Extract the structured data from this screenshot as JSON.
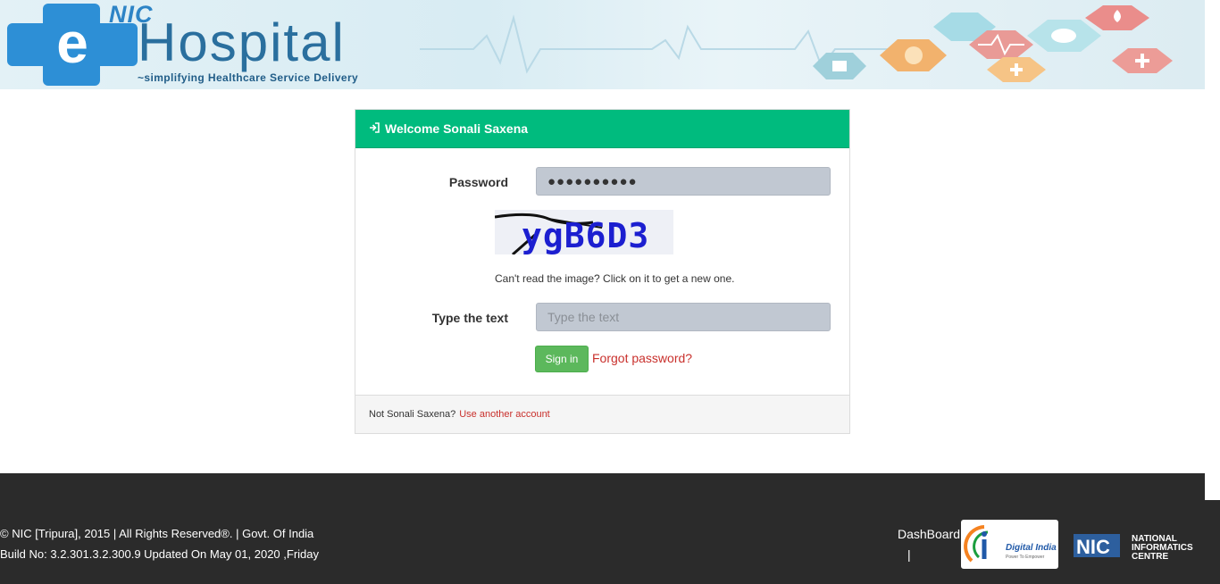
{
  "header": {
    "logo_nic": "NIC",
    "logo_e": "e",
    "logo_title": "Hospital",
    "tagline": "~simplifying Healthcare Service Delivery"
  },
  "login": {
    "welcome": "Welcome Sonali Saxena",
    "password_label": "Password",
    "password_value": "●●●●●●●●●●",
    "captcha_text": "ygB6D3",
    "captcha_hint": "Can't read the image? Click on it to get a new one.",
    "text_label": "Type the text",
    "text_placeholder": "Type the text",
    "signin_label": "Sign in",
    "forgot_label": "Forgot password?",
    "not_user_text": "Not Sonali Saxena?",
    "another_account": "Use another account"
  },
  "footer": {
    "copyright": "© NIC [Tripura], 2015 | All Rights Reserved®. | Govt. Of India",
    "build": "Build No: 3.2.301.3.2.300.9 Updated On May 01, 2020 ,Friday",
    "dashboard": "DashBoard",
    "separator": "|",
    "digital_india": "Digital India",
    "digital_india_sub": "Power To Empower",
    "nic_abbr": "NIC",
    "nic_line1": "NATIONAL",
    "nic_line2": "INFORMATICS",
    "nic_line3": "CENTRE"
  },
  "colors": {
    "header_green": "#00bb7e",
    "signin_green": "#5cb85c",
    "link_red": "#c9302c",
    "footer_bg": "#2b2b2b",
    "logo_blue": "#2d84c6"
  }
}
